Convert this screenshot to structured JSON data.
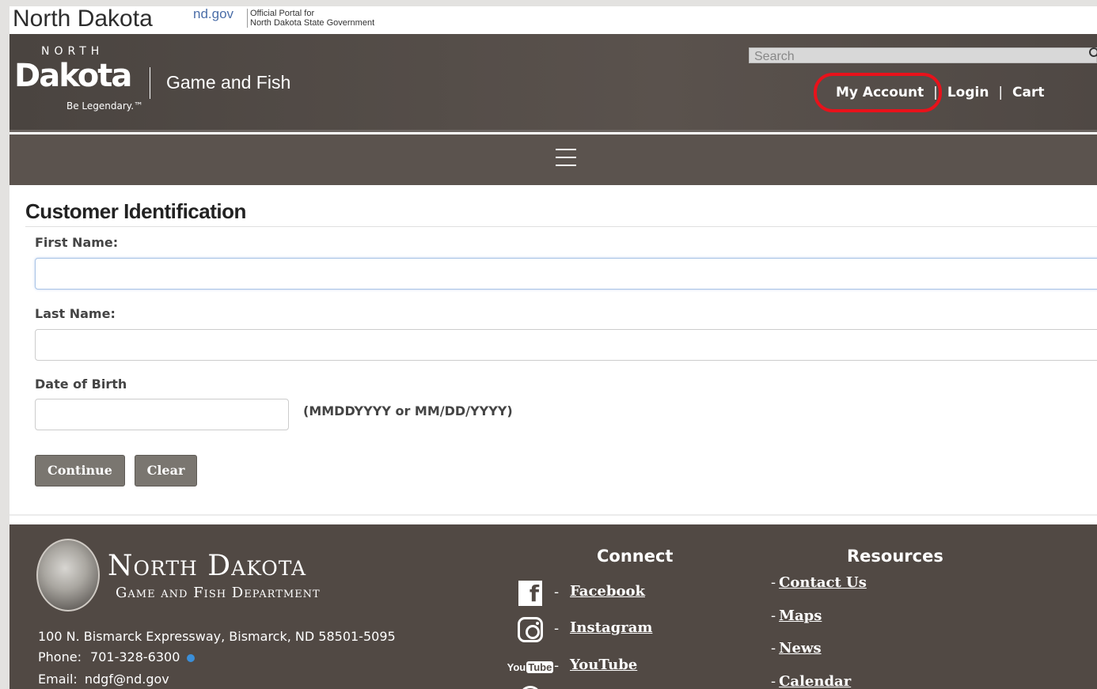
{
  "topbar": {
    "state_name": "North Dakota",
    "portal_logo": "nd.gov",
    "portal_text_line1": "Official Portal for",
    "portal_text_line2": "North Dakota State Government"
  },
  "header": {
    "brand_north": "NORTH",
    "brand_dakota": "Dakota",
    "brand_tagline": "Be Legendary.™",
    "department": "Game and Fish",
    "search_placeholder": "Search",
    "links": {
      "my_account": "My Account",
      "separator": "|",
      "login": "Login",
      "cart": "Cart"
    }
  },
  "nav": {
    "menu_icon": "hamburger-icon"
  },
  "form": {
    "title": "Customer Identification",
    "first_name_label": "First Name:",
    "first_name_value": "",
    "last_name_label": "Last Name:",
    "last_name_value": "",
    "dob_label": "Date of Birth",
    "dob_value": "",
    "dob_hint": "(MMDDYYYY or MM/DD/YYYY)",
    "continue_label": "Continue",
    "clear_label": "Clear"
  },
  "footer": {
    "dept_name_line1": "North Dakota",
    "dept_name_line2": "Game and Fish Department",
    "address": "100 N. Bismarck Expressway, Bismarck, ND 58501-5095",
    "phone_label": "Phone:",
    "phone": "701-328-6300",
    "email_label": "Email:",
    "email": "ndgf@nd.gov",
    "connect_heading": "Connect",
    "social": [
      {
        "icon": "facebook-icon",
        "label": "Facebook"
      },
      {
        "icon": "instagram-icon",
        "label": "Instagram"
      },
      {
        "icon": "youtube-icon",
        "label": "YouTube"
      }
    ],
    "resources_heading": "Resources",
    "resources": [
      "Contact Us",
      "Maps",
      "News",
      "Calendar"
    ]
  },
  "annotation": {
    "highlight_color": "#e8121b"
  }
}
